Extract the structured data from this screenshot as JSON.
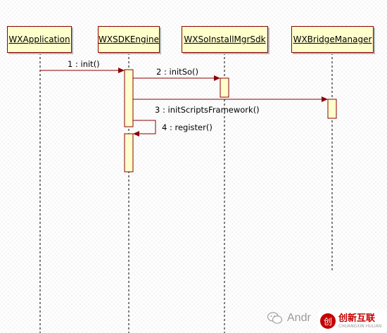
{
  "lifelines": [
    {
      "name": "WXApplication"
    },
    {
      "name": "WXSDKEngine"
    },
    {
      "name": "WXSoInstallMgrSdk"
    },
    {
      "name": "WXBridgeManager"
    }
  ],
  "messages": [
    {
      "label": "1 : init()"
    },
    {
      "label": "2 : initSo()"
    },
    {
      "label": "3 : initScriptsFramework()"
    },
    {
      "label": "4 : register()"
    }
  ],
  "colors": {
    "box_fill": "#ffffcc",
    "border": "#8b0000",
    "arrow": "#8b0000",
    "lifeline": "#000000"
  },
  "watermark": {
    "wechat_icon": "wechat-icon",
    "text": "Andr",
    "logo_mark": "创",
    "logo_text": "创新互联",
    "logo_sub": "CHUANGXIN HULIAN"
  }
}
